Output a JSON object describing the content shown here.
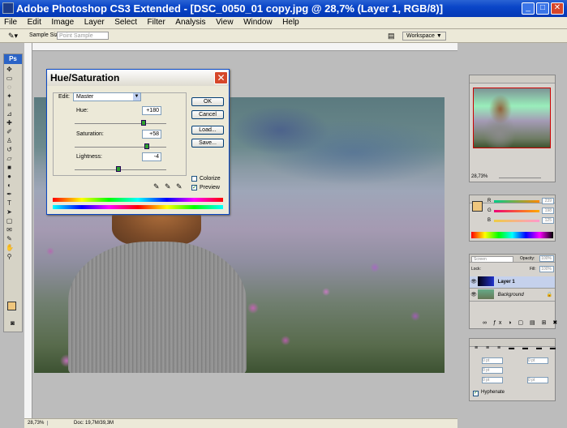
{
  "app": {
    "title": "Adobe Photoshop CS3 Extended - [DSC_0050_01 copy.jpg @ 28,7% (Layer 1, RGB/8)]"
  },
  "window_buttons": {
    "min": "_",
    "restore": "□",
    "close": "✕"
  },
  "menu": [
    "File",
    "Edit",
    "Image",
    "Layer",
    "Select",
    "Filter",
    "Analysis",
    "View",
    "Window",
    "Help"
  ],
  "options": {
    "sample_size_label": "Sample Size:",
    "sample_size_value": "Point Sample",
    "workspace": "Workspace ▼"
  },
  "status": {
    "zoom": "28,73%",
    "doc": "Doc: 19,7M/39,3M"
  },
  "dialog": {
    "title": "Hue/Saturation",
    "edit_label": "Edit:",
    "edit_value": "Master",
    "hue_label": "Hue:",
    "hue_value": "+180",
    "hue": 0.75,
    "sat_label": "Saturation:",
    "sat_value": "+58",
    "sat": 0.79,
    "light_label": "Lightness:",
    "light_value": "-4",
    "light": 0.48,
    "ok": "OK",
    "cancel": "Cancel",
    "load": "Load...",
    "save": "Save...",
    "colorize": "Colorize",
    "colorize_checked": false,
    "preview": "Preview",
    "preview_checked": true
  },
  "navigator": {
    "zoom": "28,73%"
  },
  "color_panel": {
    "r_label": "R",
    "r_value": "239",
    "g_label": "G",
    "g_value": "198",
    "b_label": "B",
    "b_value": "125"
  },
  "layers": {
    "blend": "Screen",
    "opacity_label": "Opacity:",
    "opacity": "100%",
    "lock_label": "Lock:",
    "fill_label": "Fill:",
    "fill": "100%",
    "items": [
      {
        "name": "Layer 1",
        "selected": true
      },
      {
        "name": "Background",
        "selected": false
      }
    ]
  },
  "paragraph": {
    "indent_values": [
      "0 pt",
      "0 pt",
      "0 pt",
      "0 pt",
      "0 pt"
    ],
    "hyphenate": "Hyphenate",
    "hyphenate_checked": true
  },
  "colors": {
    "accent": "#0a46c8",
    "fg_swatch": "#efc67d"
  }
}
